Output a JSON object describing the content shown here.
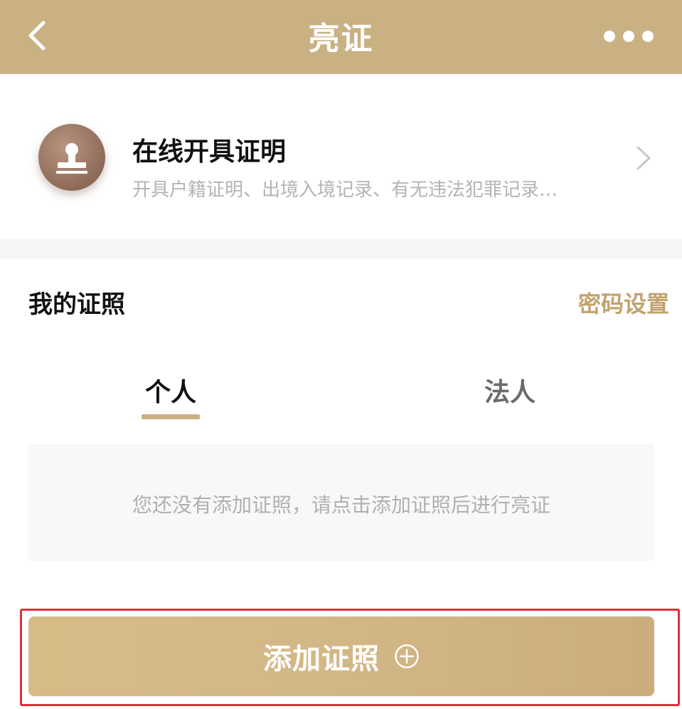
{
  "header": {
    "title": "亮证",
    "back_icon": "chevron-left-icon",
    "more_icon": "more-dots-icon"
  },
  "online_service": {
    "title": "在线开具证明",
    "subtitle": "开具户籍证明、出境入境记录、有无违法犯罪记录…",
    "icon": "stamp-icon"
  },
  "my_licenses": {
    "title": "我的证照",
    "password_link": "密码设置"
  },
  "tabs": [
    {
      "label": "个人",
      "active": true
    },
    {
      "label": "法人",
      "active": false
    }
  ],
  "empty_state": {
    "message": "您还没有添加证照，请点击添加证照后进行亮证"
  },
  "add_button": {
    "label": "添加证照",
    "icon": "plus-circle-icon"
  },
  "colors": {
    "header_bg": "#c9b184",
    "accent": "#c1a36e",
    "highlight_frame": "#e0303a"
  }
}
